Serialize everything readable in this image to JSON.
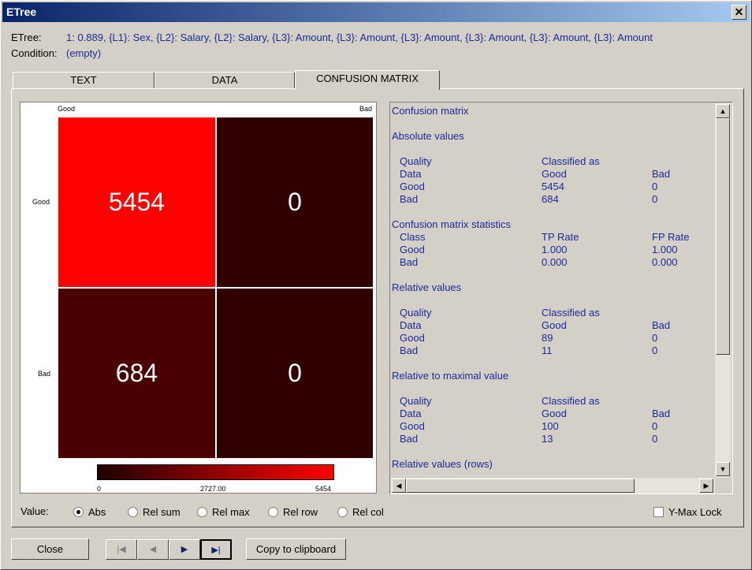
{
  "window": {
    "title": "ETree",
    "close_glyph": "✕"
  },
  "info": {
    "etree_label": "ETree:",
    "etree_value": "1: 0.889, {L1}: Sex, {L2}: Salary, {L2}: Salary, {L3}: Amount, {L3}: Amount, {L3}: Amount, {L3}: Amount, {L3}: Amount, {L3}: Amount",
    "condition_label": "Condition:",
    "condition_value": "(empty)"
  },
  "tabs": [
    {
      "label": "TEXT",
      "active": false
    },
    {
      "label": "DATA",
      "active": false
    },
    {
      "label": "CONFUSION MATRIX",
      "active": true
    }
  ],
  "matrix": {
    "col_labels": [
      "Good",
      "Bad"
    ],
    "row_labels": [
      "Good",
      "Bad"
    ],
    "values": [
      [
        "5454",
        "0"
      ],
      [
        "684",
        "0"
      ]
    ],
    "colors": {
      "max": "#ff0000",
      "low": "#4a0000",
      "zero": "#300000"
    },
    "colorbar": {
      "min": "0",
      "mid": "2727.00",
      "max": "5454"
    }
  },
  "text_panel": {
    "title": "Confusion matrix",
    "absolute": {
      "heading": "Absolute values",
      "quality": "Quality",
      "classified_as": "Classified as",
      "data": "Data",
      "good": "Good",
      "bad": "Bad",
      "row_good": [
        "Good",
        "5454",
        "0"
      ],
      "row_bad": [
        "Bad",
        "684",
        "0"
      ]
    },
    "stats": {
      "heading": "Confusion matrix statistics",
      "class": "Class",
      "tp": "TP Rate",
      "fp": "FP Rate",
      "row_good": [
        "Good",
        "1.000",
        "1.000"
      ],
      "row_bad": [
        "Bad",
        "0.000",
        "0.000"
      ]
    },
    "relative": {
      "heading": "Relative values",
      "quality": "Quality",
      "classified_as": "Classified as",
      "data": "Data",
      "good": "Good",
      "bad": "Bad",
      "row_good": [
        "Good",
        "89",
        "0"
      ],
      "row_bad": [
        "Bad",
        "11",
        "0"
      ]
    },
    "relmax": {
      "heading": "Relative to maximal value",
      "quality": "Quality",
      "classified_as": "Classified as",
      "data": "Data",
      "good": "Good",
      "bad": "Bad",
      "row_good": [
        "Good",
        "100",
        "0"
      ],
      "row_bad": [
        "Bad",
        "13",
        "0"
      ]
    },
    "relrows_heading": "Relative values (rows)"
  },
  "value_options": {
    "label": "Value:",
    "options": [
      {
        "label": "Abs",
        "selected": true
      },
      {
        "label": "Rel sum",
        "selected": false
      },
      {
        "label": "Rel max",
        "selected": false
      },
      {
        "label": "Rel row",
        "selected": false
      },
      {
        "label": "Rel col",
        "selected": false
      }
    ],
    "ymax_lock": "Y-Max Lock"
  },
  "buttons": {
    "close": "Close",
    "copy": "Copy to clipboard",
    "nav": [
      "|◀",
      "◀",
      "▶",
      "▶|"
    ]
  },
  "scroll_glyphs": {
    "up": "▲",
    "down": "▼",
    "left": "◀",
    "right": "▶"
  }
}
